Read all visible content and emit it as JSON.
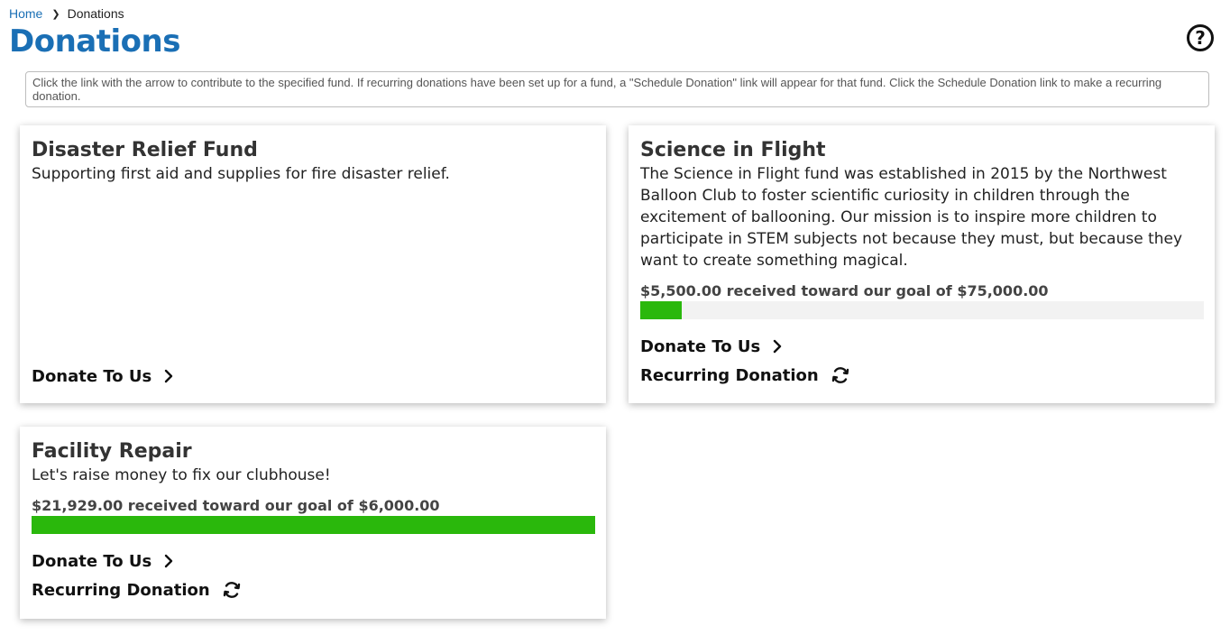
{
  "breadcrumb": {
    "home": "Home",
    "current": "Donations"
  },
  "page": {
    "title": "Donations",
    "help_icon": "question-circle-icon"
  },
  "info": "Click the link with the arrow to contribute to the specified fund. If recurring donations have been set up for a fund, a \"Schedule Donation\" link will appear for that fund. Click the Schedule Donation link to make a recurring donation.",
  "colors": {
    "accent": "#1a6fb5",
    "progress": "#2ab80c",
    "track": "#f2f2f2"
  },
  "funds": [
    {
      "title": "Disaster Relief Fund",
      "description": "Supporting first aid and supplies for fire disaster relief.",
      "donate_label": "Donate To Us"
    },
    {
      "title": "Science in Flight",
      "description": "The Science in Flight fund was established in 2015 by the Northwest Balloon Club to foster scientific curiosity in children through the excitement of ballooning. Our mission is to inspire more children to participate in STEM subjects not because they must, but because they want to create something magical.",
      "progress_text": "$5,500.00 received toward our goal of $75,000.00",
      "progress_fraction": 0.0733,
      "donate_label": "Donate To Us",
      "recurring_label": "Recurring Donation"
    },
    {
      "title": "Facility Repair",
      "description": "Let's raise money to fix our clubhouse!",
      "progress_text": "$21,929.00 received toward our goal of $6,000.00",
      "progress_fraction": 1.0,
      "donate_label": "Donate To Us",
      "recurring_label": "Recurring Donation"
    }
  ]
}
